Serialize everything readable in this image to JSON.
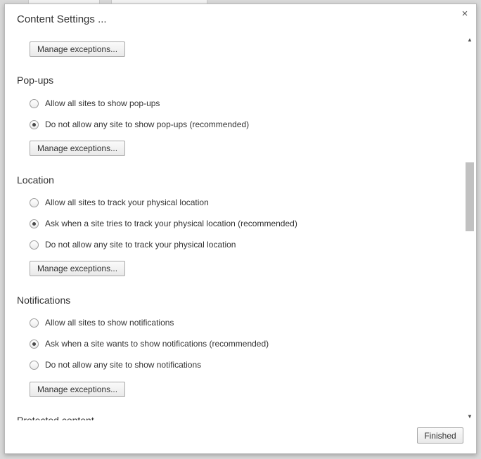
{
  "dialog": {
    "title": "Content Settings ...",
    "close_label": "×",
    "finished_label": "Finished"
  },
  "top": {
    "manage_label": "Manage exceptions..."
  },
  "sections": [
    {
      "title": "Pop-ups",
      "options": [
        {
          "label": "Allow all sites to show pop-ups",
          "selected": false
        },
        {
          "label": "Do not allow any site to show pop-ups (recommended)",
          "selected": true
        }
      ],
      "manage_label": "Manage exceptions..."
    },
    {
      "title": "Location",
      "options": [
        {
          "label": "Allow all sites to track your physical location",
          "selected": false
        },
        {
          "label": "Ask when a site tries to track your physical location (recommended)",
          "selected": true
        },
        {
          "label": "Do not allow any site to track your physical location",
          "selected": false
        }
      ],
      "manage_label": "Manage exceptions..."
    },
    {
      "title": "Notifications",
      "options": [
        {
          "label": "Allow all sites to show notifications",
          "selected": false
        },
        {
          "label": "Ask when a site wants to show notifications (recommended)",
          "selected": true
        },
        {
          "label": "Do not allow any site to show notifications",
          "selected": false
        }
      ],
      "manage_label": "Manage exceptions..."
    }
  ],
  "next_section_title": "Protected content",
  "scrollbar": {
    "up_arrow": "▲",
    "down_arrow": "▼"
  },
  "icons": {
    "close": "close-icon",
    "radio_selected": "radio-selected",
    "radio_unselected": "radio-unselected"
  }
}
